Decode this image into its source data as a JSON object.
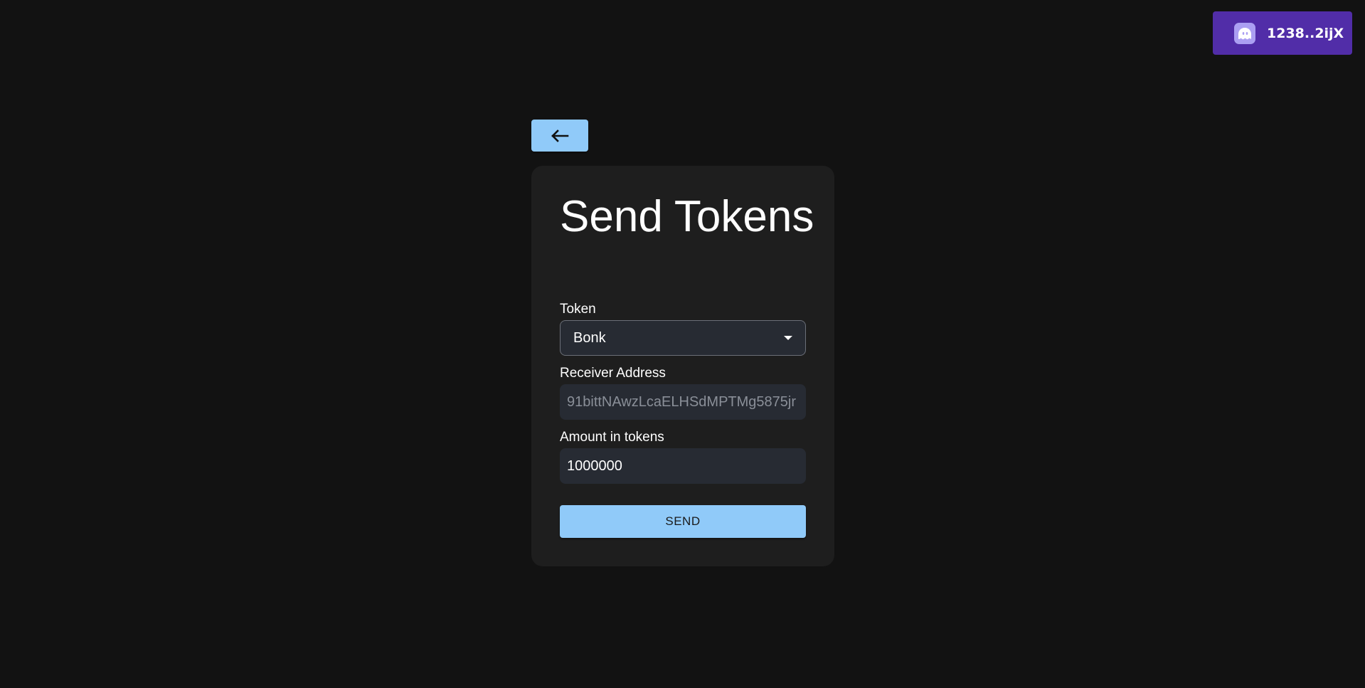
{
  "wallet": {
    "label": "1238..2ijX",
    "icon": "phantom-ghost-icon",
    "color": "#512da8"
  },
  "nav": {
    "back_icon": "arrow-left-icon"
  },
  "form": {
    "title": "Send Tokens",
    "token": {
      "label": "Token",
      "selected": "Bonk"
    },
    "receiver": {
      "label": "Receiver Address",
      "placeholder": "91bittNAwzLcaELHSdMPTMg5875jr",
      "value": ""
    },
    "amount": {
      "label": "Amount in tokens",
      "value": "1000000"
    },
    "submit_label": "SEND"
  },
  "colors": {
    "accent": "#90caf9",
    "background": "#121212",
    "card": "#1e1e1e",
    "input": "#272b33"
  }
}
